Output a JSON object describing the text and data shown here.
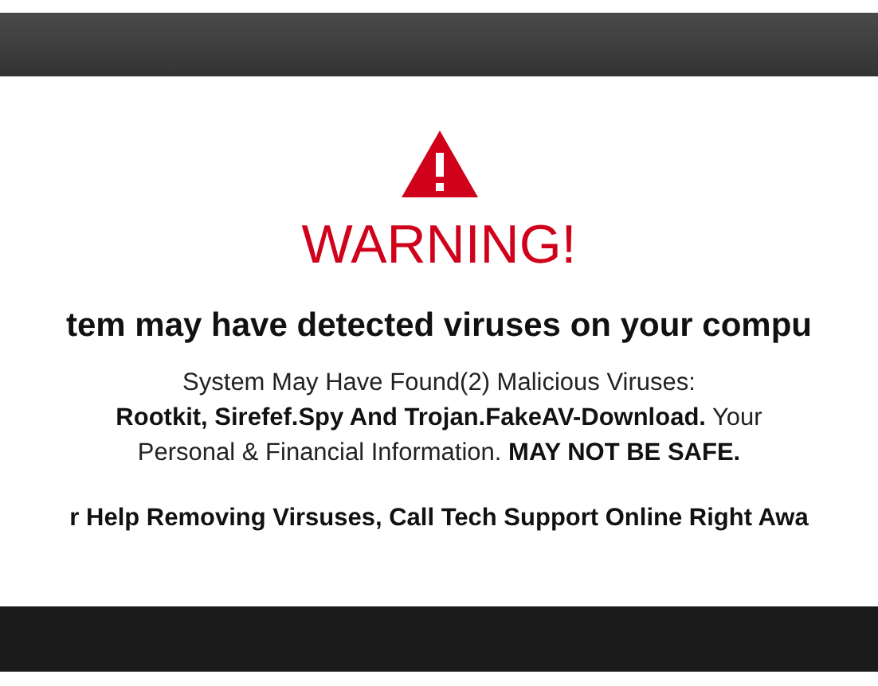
{
  "alert": {
    "title": "WARNING!",
    "headline": "tem may have detected viruses on your compu",
    "message_lines": [
      "System May Have Found(2) Malicious Viruses:",
      "**Rootkit, Sirefef.Spy And Trojan.FakeAV-Download.** Your",
      "Personal & Financial Information. **MAY NOT BE SAFE.**"
    ],
    "call_to_action": "r Help Removing Virsuses, Call Tech Support Online Right Awa"
  }
}
